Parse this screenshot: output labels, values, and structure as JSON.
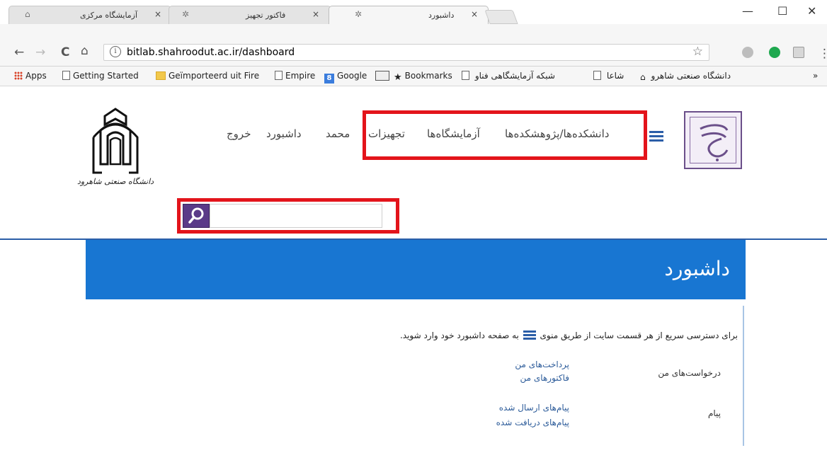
{
  "browser": {
    "tabs": [
      {
        "title": "آزمایشگاه مرکزی",
        "icon": "university-favicon"
      },
      {
        "title": "فاکتور تجهیز",
        "icon": "gear-favicon"
      },
      {
        "title": "داشبورد",
        "icon": "gear-favicon"
      }
    ],
    "close_glyph": "×",
    "window_controls": {
      "minimize": "—",
      "maximize": "☐",
      "close": "✕"
    },
    "nav": {
      "back": "←",
      "forward": "→",
      "reload": "C",
      "home": "⌂"
    },
    "url": "bitlab.shahroodut.ac.ir/dashboard",
    "info_glyph": "i",
    "star_glyph": "☆",
    "overflow_glyph": "⋮",
    "bookmarks": [
      {
        "label": "Apps",
        "icon": "apps-grid-icon"
      },
      {
        "label": "Getting Started",
        "icon": "page-icon"
      },
      {
        "label": "Geïmporteerd uit Fire",
        "icon": "folder-icon"
      },
      {
        "label": "Empire",
        "icon": "page-icon"
      },
      {
        "label": "Google",
        "icon": "google-icon"
      },
      {
        "label": "Bookmarks",
        "icon": "star-icon"
      },
      {
        "label": "شبکه آزمایشگاهی فناو",
        "icon": "page-icon"
      },
      {
        "label": "شاعا",
        "icon": "page-icon"
      },
      {
        "label": "دانشگاه صنعتی شاهرو",
        "icon": "university-icon"
      }
    ],
    "bookmarks_more": "»"
  },
  "header": {
    "nav_items": [
      "دانشکده‌ها/پژوهشکده‌ها",
      "آزمایشگاه‌ها",
      "تجهیزات"
    ],
    "user_items": [
      "محمد",
      "داشبورد",
      "خروج"
    ],
    "university_caption": "دانشگاه صنعتی شاهرود"
  },
  "search": {
    "placeholder": ""
  },
  "banner": {
    "title": "داشبورد"
  },
  "dashboard": {
    "intro_before": "برای دسترسی سریع از هر قسمت سایت از طریق منوی",
    "intro_after": "به صفحه داشبورد خود وارد شوید.",
    "sections": [
      {
        "label": "درخواست‌های من",
        "links": [
          "پرداخت‌های من",
          "فاکتورهای من"
        ]
      },
      {
        "label": "پیام",
        "links": [
          "پیام‌های ارسال شده",
          "پیام‌های دریافت شده"
        ]
      }
    ]
  },
  "colors": {
    "banner": "#1876d2",
    "highlight": "#e3141b",
    "link": "#2d5c9a",
    "brand_purple": "#5a3a88"
  }
}
